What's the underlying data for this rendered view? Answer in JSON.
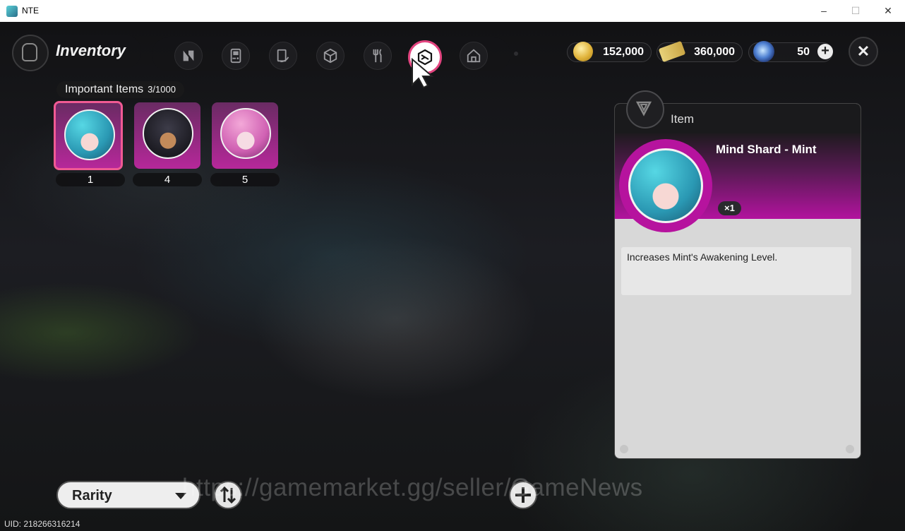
{
  "window": {
    "title": "NTE",
    "controls": [
      "–",
      "☐",
      "✕"
    ]
  },
  "header": {
    "title": "Inventory",
    "tabs": [
      {
        "icon": "n-logo-icon",
        "active": false
      },
      {
        "icon": "gameboy-icon",
        "active": false
      },
      {
        "icon": "book-icon",
        "active": false
      },
      {
        "icon": "box-icon",
        "active": false
      },
      {
        "icon": "utensils-icon",
        "active": false
      },
      {
        "icon": "important-items-icon",
        "active": true
      },
      {
        "icon": "home-icon",
        "active": false
      }
    ],
    "currencies": [
      {
        "icon": "gold-coin-icon",
        "value": "152,000"
      },
      {
        "icon": "ticket-icon",
        "value": "360,000"
      },
      {
        "icon": "blue-orb-icon",
        "value": "50"
      }
    ],
    "close_label": "✕"
  },
  "section": {
    "label": "Important Items",
    "count": "3/1000"
  },
  "items": [
    {
      "name": "mint-shard",
      "count": "1",
      "selected": true
    },
    {
      "name": "dog-shard",
      "count": "4",
      "selected": false
    },
    {
      "name": "pink-shard",
      "count": "5",
      "selected": false
    }
  ],
  "detail": {
    "header": "Item",
    "name": "Mind Shard - Mint",
    "quantity": "×1",
    "description": "Increases Mint's Awakening Level."
  },
  "footer": {
    "sort_label": "Rarity",
    "uid": "UID: 218266316214",
    "watermark": "https://gamemarket.gg/seller/GameNews"
  },
  "colors": {
    "accent": "#e2447f",
    "item_purple": "#b6289a",
    "panel_bg": "#d8d8d8"
  }
}
